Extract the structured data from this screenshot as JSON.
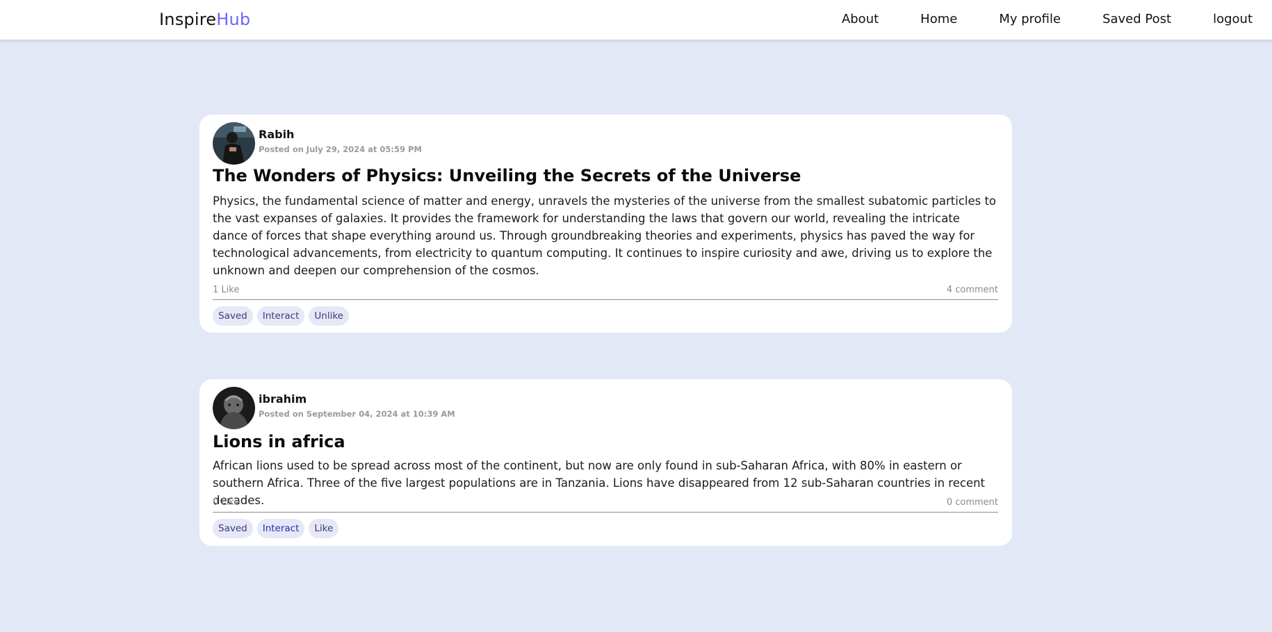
{
  "nav": {
    "brand_part1": "Inspire",
    "brand_part2": "Hub",
    "links": [
      "About",
      "Home",
      "My profile",
      "Saved Post",
      "logout"
    ]
  },
  "posts": [
    {
      "author": "Rabih",
      "date": "Posted on July 29, 2024 at 05:59 PM",
      "title": "The Wonders of Physics: Unveiling the Secrets of the Universe",
      "body": "Physics, the fundamental science of matter and energy, unravels the mysteries of the universe from the smallest subatomic particles to the vast expanses of galaxies. It provides the framework for understanding the laws that govern our world, revealing the intricate dance of forces that shape everything around us. Through groundbreaking theories and experiments, physics has paved the way for technological advancements, from electricity to quantum computing. It continues to inspire curiosity and awe, driving us to explore the unknown and deepen our comprehension of the cosmos.",
      "likes": "1 Like",
      "comments": "4 comment",
      "actions": [
        "Saved",
        "Interact",
        "Unlike"
      ]
    },
    {
      "author": "ibrahim",
      "date": "Posted on September 04, 2024 at 10:39 AM",
      "title": "Lions in africa",
      "body": "African lions used to be spread across most of the continent, but now are only found in sub-Saharan Africa, with 80% in eastern or southern Africa. Three of the five largest populations are in Tanzania. Lions have disappeared from 12 sub-Saharan countries in recent decades.",
      "likes": "0 Like",
      "comments": "0 comment",
      "actions": [
        "Saved",
        "Interact",
        "Like"
      ]
    }
  ],
  "colors": {
    "accent": "#6c63ff",
    "background": "#e2e8f6",
    "pill": "#e6e8f6"
  }
}
